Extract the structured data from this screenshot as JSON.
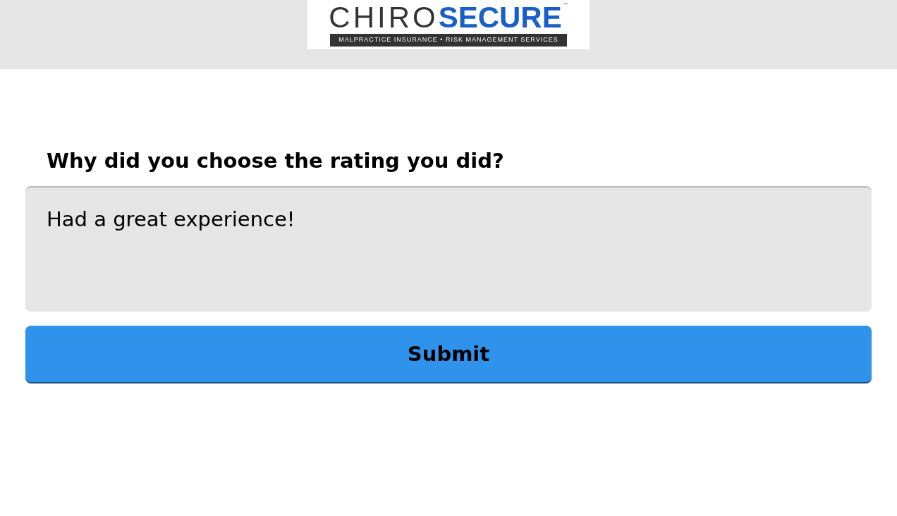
{
  "logo": {
    "word_1": "CHIRO",
    "word_2": "SECURE",
    "trademark": "™",
    "tagline": "MALPRACTICE INSURANCE • RISK MANAGEMENT SERVICES"
  },
  "question": {
    "label": "Why did you choose the rating you did?",
    "value": "Had a great experience!"
  },
  "submit": {
    "label": "Submit"
  }
}
